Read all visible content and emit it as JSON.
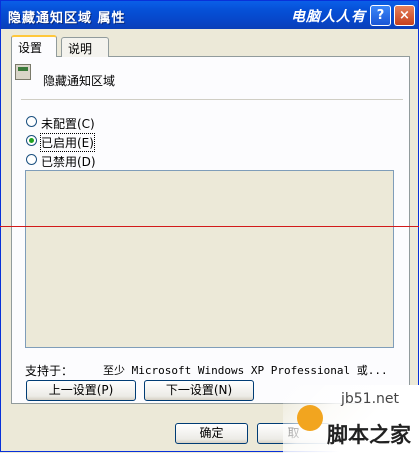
{
  "window": {
    "title": "隐藏通知区域 属性",
    "watermark_top": "电脑人人有",
    "help_label": "?",
    "close_label": "×"
  },
  "tabs": [
    {
      "label": "设置",
      "active": true
    },
    {
      "label": "说明",
      "active": false
    }
  ],
  "policy": {
    "name": "隐藏通知区域"
  },
  "options": [
    {
      "label": "未配置(C)",
      "checked": false
    },
    {
      "label": "已启用(E)",
      "checked": true
    },
    {
      "label": "已禁用(D)",
      "checked": false
    }
  ],
  "supported": {
    "label": "支持于：",
    "value": "至少 Microsoft Windows XP Professional 或..."
  },
  "buttons": {
    "prev": "上一设置(P)",
    "next": "下一设置(N)",
    "ok": "确定",
    "cancel": "取"
  },
  "watermark_corner": {
    "site": "jb51.net",
    "name": "脚本之家"
  },
  "colors": {
    "titlebar": "#0651D8",
    "dialog_bg": "#ECE9D8",
    "accent_tab": "#FFC83C",
    "radio_checked": "#21A121",
    "red_line": "#D21A1A"
  }
}
